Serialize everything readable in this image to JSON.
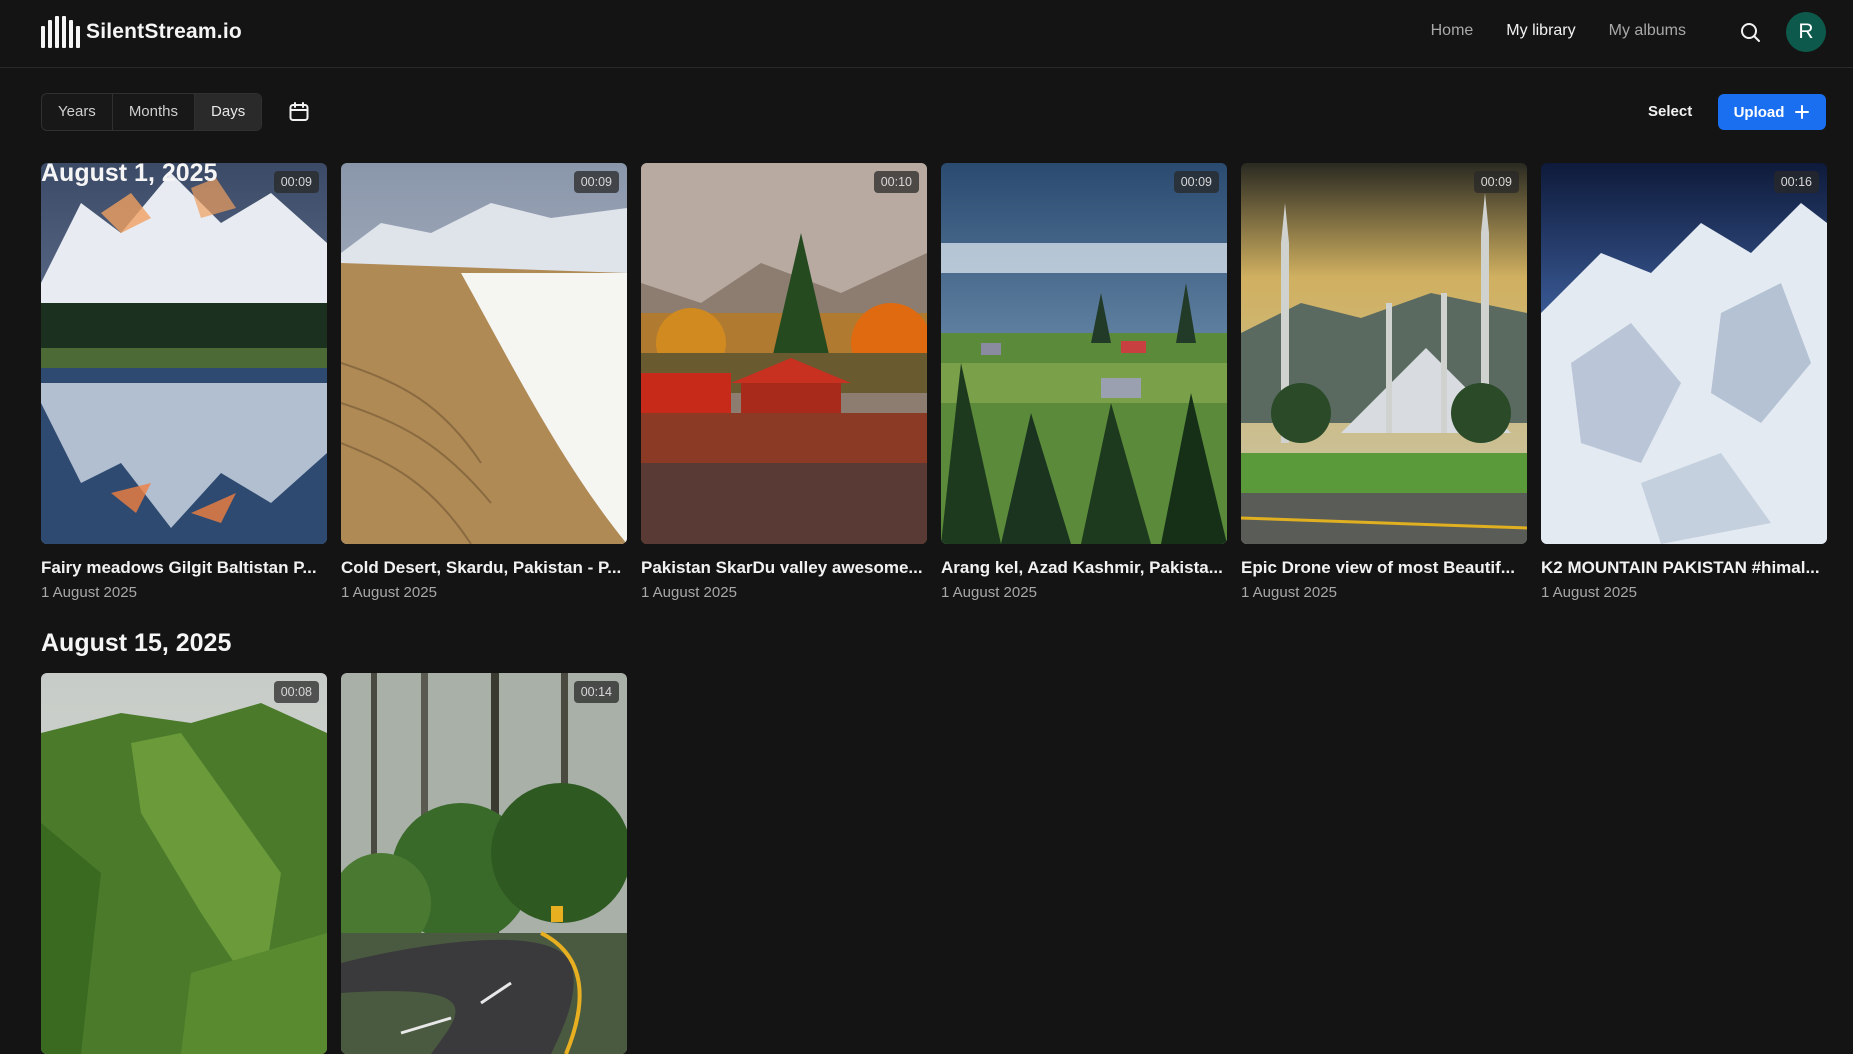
{
  "app": {
    "name": "SilentStream.io"
  },
  "nav": {
    "home": "Home",
    "library": "My library",
    "albums": "My albums"
  },
  "user": {
    "initial": "R"
  },
  "toolbar": {
    "views": [
      "Years",
      "Months",
      "Days"
    ],
    "active_view": "Days",
    "select_label": "Select",
    "upload_label": "Upload"
  },
  "icons": {
    "search": "search-icon",
    "calendar": "calendar-icon",
    "upload": "plus-icon"
  },
  "colors": {
    "accent": "#1a6ff0",
    "avatar": "#0d5a4c",
    "background": "#141414"
  },
  "sections": [
    {
      "title": "August 1, 2025",
      "videos": [
        {
          "title": "Fairy meadows Gilgit Baltistan P...",
          "date": "1 August 2025",
          "duration": "00:09"
        },
        {
          "title": "Cold Desert, Skardu, Pakistan - P...",
          "date": "1 August 2025",
          "duration": "00:09"
        },
        {
          "title": "Pakistan SkarDu valley awesome...",
          "date": "1 August 2025",
          "duration": "00:10"
        },
        {
          "title": "Arang kel, Azad Kashmir, Pakista...",
          "date": "1 August 2025",
          "duration": "00:09"
        },
        {
          "title": "Epic Drone view of most Beautif...",
          "date": "1 August 2025",
          "duration": "00:09"
        },
        {
          "title": "K2 MOUNTAIN PAKISTAN #himal...",
          "date": "1 August 2025",
          "duration": "00:16"
        }
      ]
    },
    {
      "title": "August 15, 2025",
      "videos": [
        {
          "duration": "00:08"
        },
        {
          "duration": "00:14"
        }
      ]
    }
  ]
}
